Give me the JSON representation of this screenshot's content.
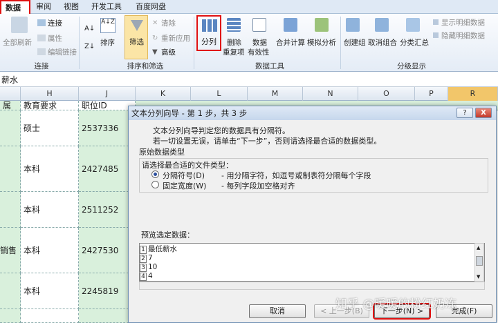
{
  "ribbon": {
    "tabs": [
      "数据",
      "审阅",
      "视图",
      "开发工具",
      "百度网盘"
    ],
    "connections": {
      "refresh_all": "全部刷新",
      "connect": "连接",
      "properties": "属性",
      "edit_links": "编辑链接",
      "group": "连接"
    },
    "sort_filter": {
      "sort_az": "A↓Z",
      "sort": "排序",
      "filter": "筛选",
      "clear": "清除",
      "reapply": "重新应用",
      "advanced": "高级",
      "group": "排序和筛选"
    },
    "data_tools": {
      "text_to_columns": "分列",
      "remove_dupes": "删除",
      "remove_dupes_2": "重复项",
      "validation": "数据",
      "validation_2": "有效性",
      "consolidate": "合并计算",
      "what_if": "模拟分析",
      "group": "数据工具"
    },
    "outline": {
      "group_btn": "创建组",
      "ungroup": "取消组合",
      "subtotal": "分类汇总",
      "show_detail": "显示明细数据",
      "hide_detail": "隐藏明细数据",
      "group": "分级显示"
    }
  },
  "formula_bar": {
    "value": "薪水"
  },
  "columns": [
    "H",
    "J",
    "K",
    "L",
    "M",
    "N",
    "O",
    "P",
    "R"
  ],
  "header_row": {
    "g": "属",
    "h": "教育要求",
    "j": "职位ID"
  },
  "rows": [
    {
      "g": "",
      "h": "硕士",
      "j": "2537336"
    },
    {
      "g": "",
      "h": "本科",
      "j": "2427485"
    },
    {
      "g": "",
      "h": "本科",
      "j": "2511252"
    },
    {
      "g": "销售",
      "h": "本科",
      "j": "2427530"
    },
    {
      "g": "",
      "h": "本科",
      "j": "2245819"
    },
    {
      "g": "",
      "h": "",
      "j": ""
    }
  ],
  "dialog": {
    "title": "文本分列向导 - 第 1 步，共 3 步",
    "help": "?",
    "close": "X",
    "line1": "文本分列向导判定您的数据具有分隔符。",
    "line2": "若一切设置无误，请单击“下一步”，否则请选择最合适的数据类型。",
    "group_title": "原始数据类型",
    "group_prompt": "请选择最合适的文件类型：",
    "opt1_label": "分隔符号(D)",
    "opt1_desc": "- 用分隔字符，如逗号或制表符分隔每个字段",
    "opt2_label": "固定宽度(W)",
    "opt2_desc": "- 每列字段加空格对齐",
    "preview_label": "预览选定数据：",
    "preview_rows": [
      {
        "n": "1",
        "v": "最低薪水"
      },
      {
        "n": "2",
        "v": "7"
      },
      {
        "n": "3",
        "v": "10"
      },
      {
        "n": "4",
        "v": "4"
      }
    ],
    "btn_cancel": "取消",
    "btn_back": "< 上一步(B)",
    "btn_next": "下一步(N) >",
    "btn_finish": "完成(F)"
  },
  "watermark": "知乎 @暖暖的粉红奶冻"
}
